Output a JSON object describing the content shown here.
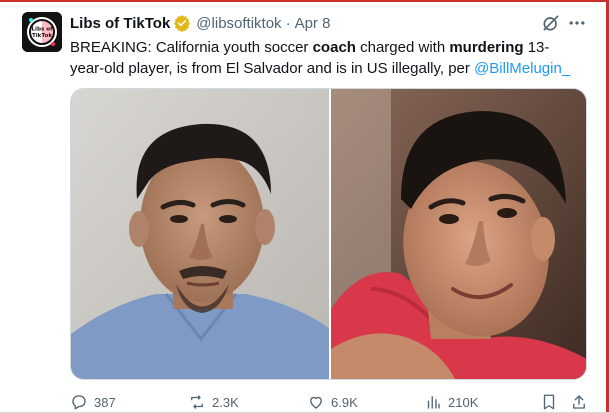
{
  "tweet": {
    "author_name": "Libs of TikTok",
    "handle": "@libsoftiktok",
    "separator": "·",
    "date": "Apr 8",
    "text_parts": {
      "p1": "BREAKING: California youth soccer ",
      "b1": "coach",
      "p2": " charged with ",
      "b2": "murdering",
      "p3": " 13-year-old player, is from El Salvador and is in US illegally, per ",
      "mention": "@BillMelugin_"
    },
    "avatar_text": {
      "line1": "Libs of",
      "line2": "TikTok"
    }
  },
  "actions": {
    "replies": "387",
    "reposts": "2.3K",
    "likes": "6.9K",
    "views": "210K"
  },
  "icons": {
    "verified": "verified-badge-icon",
    "grok": "grok-icon",
    "more": "more-icon",
    "reply": "reply-icon",
    "repost": "repost-icon",
    "like": "like-icon",
    "views": "views-icon",
    "bookmark": "bookmark-icon",
    "share": "share-icon"
  },
  "colors": {
    "accent": "#1d9bf0",
    "verified_gold": "#e2b719",
    "muted_text": "#536471",
    "text": "#0f1419"
  }
}
